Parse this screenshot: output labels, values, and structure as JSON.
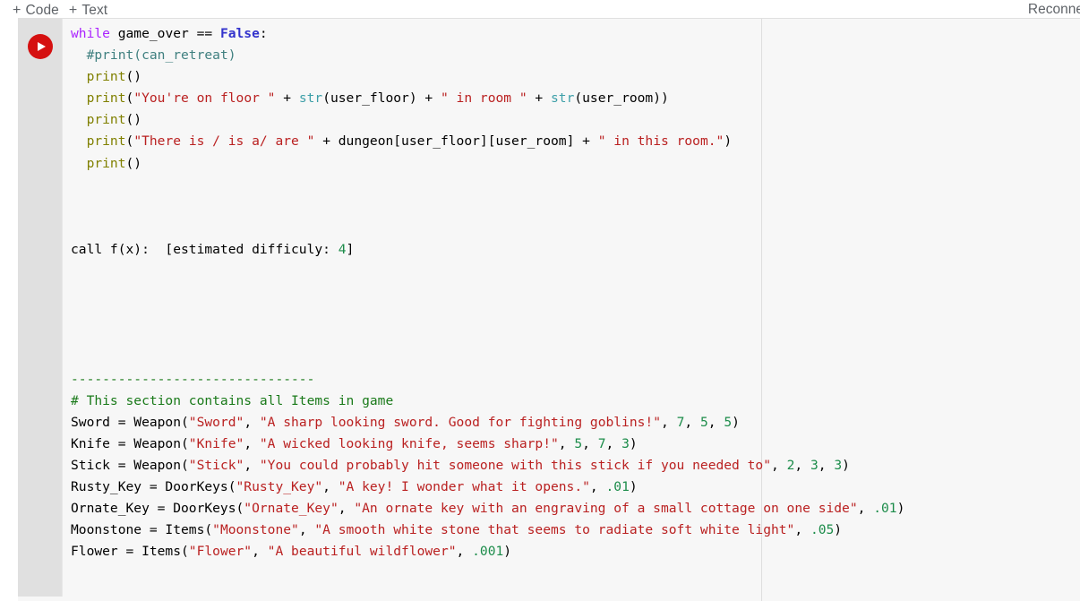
{
  "toolbar": {
    "add_code_label": "Code",
    "add_text_label": "Text",
    "plus_glyph": "+",
    "reconnect_label": "Reconnect"
  },
  "cell": {
    "run_button_title": "Run cell",
    "ruler_column": 80
  },
  "code": {
    "lines": [
      {
        "id": "l1",
        "indent": 0,
        "tokens": [
          {
            "t": "kw",
            "v": "while"
          },
          {
            "t": "pln",
            "v": " game_over == "
          },
          {
            "t": "cst",
            "v": "False"
          },
          {
            "t": "pln",
            "v": ":"
          }
        ]
      },
      {
        "id": "l2",
        "indent": 1,
        "tokens": [
          {
            "t": "cmt",
            "v": "#print(can_retreat)"
          }
        ]
      },
      {
        "id": "l3",
        "indent": 1,
        "tokens": [
          {
            "t": "fn",
            "v": "print"
          },
          {
            "t": "pln",
            "v": "()"
          }
        ]
      },
      {
        "id": "l4",
        "indent": 1,
        "tokens": [
          {
            "t": "fn",
            "v": "print"
          },
          {
            "t": "pln",
            "v": "("
          },
          {
            "t": "str",
            "v": "\"You're on floor \""
          },
          {
            "t": "pln",
            "v": " + "
          },
          {
            "t": "bi",
            "v": "str"
          },
          {
            "t": "pln",
            "v": "(user_floor) + "
          },
          {
            "t": "str",
            "v": "\" in room \""
          },
          {
            "t": "pln",
            "v": " + "
          },
          {
            "t": "bi",
            "v": "str"
          },
          {
            "t": "pln",
            "v": "(user_room))"
          }
        ]
      },
      {
        "id": "l5",
        "indent": 1,
        "tokens": [
          {
            "t": "fn",
            "v": "print"
          },
          {
            "t": "pln",
            "v": "()"
          }
        ]
      },
      {
        "id": "l6",
        "indent": 1,
        "tokens": [
          {
            "t": "fn",
            "v": "print"
          },
          {
            "t": "pln",
            "v": "("
          },
          {
            "t": "str",
            "v": "\"There is / is a/ are \""
          },
          {
            "t": "pln",
            "v": " + dungeon[user_floor][user_room] + "
          },
          {
            "t": "str",
            "v": "\" in this room.\""
          },
          {
            "t": "pln",
            "v": ")"
          }
        ]
      },
      {
        "id": "l7",
        "indent": 1,
        "tokens": [
          {
            "t": "fn",
            "v": "print"
          },
          {
            "t": "pln",
            "v": "()"
          }
        ]
      },
      {
        "id": "l8",
        "indent": 0,
        "tokens": []
      },
      {
        "id": "l9",
        "indent": 0,
        "tokens": []
      },
      {
        "id": "l10",
        "indent": 0,
        "tokens": []
      },
      {
        "id": "l11",
        "indent": 0,
        "tokens": [
          {
            "t": "pln",
            "v": "call f(x):  [estimated difficuly: "
          },
          {
            "t": "num",
            "v": "4"
          },
          {
            "t": "pln",
            "v": "]"
          }
        ]
      },
      {
        "id": "l12",
        "indent": 0,
        "tokens": []
      },
      {
        "id": "l13",
        "indent": 0,
        "tokens": []
      },
      {
        "id": "l14",
        "indent": 0,
        "tokens": []
      },
      {
        "id": "l15",
        "indent": 0,
        "tokens": []
      },
      {
        "id": "l16",
        "indent": 0,
        "tokens": []
      },
      {
        "id": "l17",
        "indent": 0,
        "tokens": [
          {
            "t": "dash",
            "v": "-------------------------------"
          }
        ]
      },
      {
        "id": "l18",
        "indent": 0,
        "tokens": [
          {
            "t": "cmt2",
            "v": "# This section contains all Items in game"
          }
        ]
      },
      {
        "id": "l19",
        "indent": 0,
        "tokens": [
          {
            "t": "pln",
            "v": "Sword = Weapon("
          },
          {
            "t": "str",
            "v": "\"Sword\""
          },
          {
            "t": "pln",
            "v": ", "
          },
          {
            "t": "str",
            "v": "\"A sharp looking sword. Good for fighting goblins!\""
          },
          {
            "t": "pln",
            "v": ", "
          },
          {
            "t": "num",
            "v": "7"
          },
          {
            "t": "pln",
            "v": ", "
          },
          {
            "t": "num",
            "v": "5"
          },
          {
            "t": "pln",
            "v": ", "
          },
          {
            "t": "num",
            "v": "5"
          },
          {
            "t": "pln",
            "v": ")"
          }
        ]
      },
      {
        "id": "l20",
        "indent": 0,
        "tokens": [
          {
            "t": "pln",
            "v": "Knife = Weapon("
          },
          {
            "t": "str",
            "v": "\"Knife\""
          },
          {
            "t": "pln",
            "v": ", "
          },
          {
            "t": "str",
            "v": "\"A wicked looking knife, seems sharp!\""
          },
          {
            "t": "pln",
            "v": ", "
          },
          {
            "t": "num",
            "v": "5"
          },
          {
            "t": "pln",
            "v": ", "
          },
          {
            "t": "num",
            "v": "7"
          },
          {
            "t": "pln",
            "v": ", "
          },
          {
            "t": "num",
            "v": "3"
          },
          {
            "t": "pln",
            "v": ")"
          }
        ]
      },
      {
        "id": "l21",
        "indent": 0,
        "tokens": [
          {
            "t": "pln",
            "v": "Stick = Weapon("
          },
          {
            "t": "str",
            "v": "\"Stick\""
          },
          {
            "t": "pln",
            "v": ", "
          },
          {
            "t": "str",
            "v": "\"You could probably hit someone with this stick if you needed to\""
          },
          {
            "t": "pln",
            "v": ", "
          },
          {
            "t": "num",
            "v": "2"
          },
          {
            "t": "pln",
            "v": ", "
          },
          {
            "t": "num",
            "v": "3"
          },
          {
            "t": "pln",
            "v": ", "
          },
          {
            "t": "num",
            "v": "3"
          },
          {
            "t": "pln",
            "v": ")"
          }
        ]
      },
      {
        "id": "l22",
        "indent": 0,
        "tokens": [
          {
            "t": "pln",
            "v": "Rusty_Key = DoorKeys("
          },
          {
            "t": "str",
            "v": "\"Rusty_Key\""
          },
          {
            "t": "pln",
            "v": ", "
          },
          {
            "t": "str",
            "v": "\"A key! I wonder what it opens.\""
          },
          {
            "t": "pln",
            "v": ", "
          },
          {
            "t": "num",
            "v": ".01"
          },
          {
            "t": "pln",
            "v": ")"
          }
        ]
      },
      {
        "id": "l23",
        "indent": 0,
        "tokens": [
          {
            "t": "pln",
            "v": "Ornate_Key = DoorKeys("
          },
          {
            "t": "str",
            "v": "\"Ornate_Key\""
          },
          {
            "t": "pln",
            "v": ", "
          },
          {
            "t": "str",
            "v": "\"An ornate key with an engraving of a small cottage on one side\""
          },
          {
            "t": "pln",
            "v": ", "
          },
          {
            "t": "num",
            "v": ".01"
          },
          {
            "t": "pln",
            "v": ")"
          }
        ]
      },
      {
        "id": "l24",
        "indent": 0,
        "tokens": [
          {
            "t": "pln",
            "v": "Moonstone = Items("
          },
          {
            "t": "str",
            "v": "\"Moonstone\""
          },
          {
            "t": "pln",
            "v": ", "
          },
          {
            "t": "str",
            "v": "\"A smooth white stone that seems to radiate soft white light\""
          },
          {
            "t": "pln",
            "v": ", "
          },
          {
            "t": "num",
            "v": ".05"
          },
          {
            "t": "pln",
            "v": ")"
          }
        ]
      },
      {
        "id": "l25",
        "indent": 0,
        "tokens": [
          {
            "t": "pln",
            "v": "Flower = Items("
          },
          {
            "t": "str",
            "v": "\"Flower\""
          },
          {
            "t": "pln",
            "v": ", "
          },
          {
            "t": "str",
            "v": "\"A beautiful wildflower\""
          },
          {
            "t": "pln",
            "v": ", "
          },
          {
            "t": "num",
            "v": ".001"
          },
          {
            "t": "pln",
            "v": ")"
          }
        ]
      }
    ]
  },
  "colors": {
    "run_button": "#d51010",
    "cell_background": "#f7f7f7",
    "gutter": "#e0e0e0",
    "keyword": "#aa22ff",
    "constant": "#3333cc",
    "comment": "#408080",
    "comment_section": "#1a7a1a",
    "string": "#ba2121",
    "function": "#808000",
    "builtin": "#3d9fa8",
    "number": "#1c8c4a",
    "toolbar_text": "#5f6368"
  }
}
